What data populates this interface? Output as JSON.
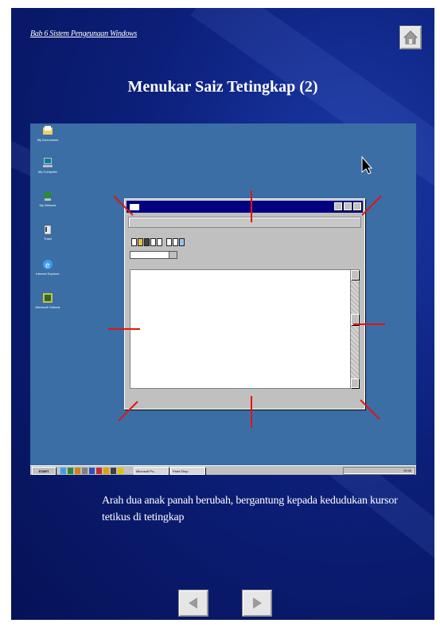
{
  "breadcrumb": "Bab 6 Sistem Pengeunaan Windows",
  "title": "Menukar Saiz Tetingkap (2)",
  "caption": "Arah dua anak panah berubah, bergantung kepada kedudukan kursor tetikus di tetingkap",
  "desktop": {
    "icons": [
      {
        "label": "My Documents",
        "icon": "folder-documents-icon"
      },
      {
        "label": "My Computer",
        "icon": "computer-icon"
      },
      {
        "label": "My Network",
        "icon": "network-icon"
      },
      {
        "label": "Trash",
        "icon": "recycle-bin-icon"
      },
      {
        "label": "Internet Explorer",
        "icon": "internet-explorer-icon"
      },
      {
        "label": "Microsoft Outlook",
        "icon": "outlook-icon"
      }
    ],
    "taskbar": {
      "start_label": "START",
      "tasks": [
        "Microsoft Po...",
        "Paint Shop"
      ],
      "clock": "10:40"
    }
  },
  "colors": {
    "slide_bg": "#0c1f7a",
    "desktop_bg": "#3a6ea5",
    "titlebar": "#000080",
    "marker": "#e81010"
  }
}
